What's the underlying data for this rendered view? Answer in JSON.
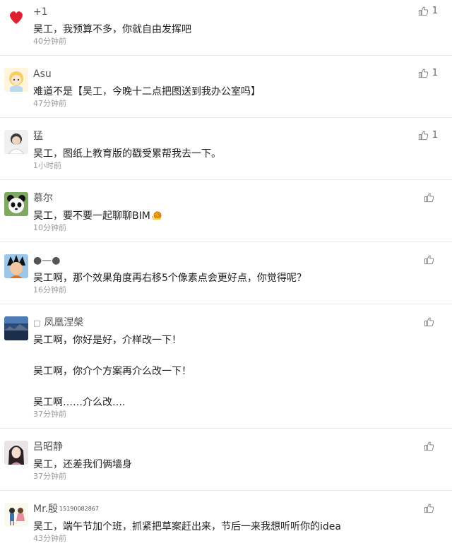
{
  "comments": [
    {
      "name": "+1",
      "text": [
        "吴工，我预算不多，你就自由发挥吧"
      ],
      "time": "40分钟前",
      "likes": "1",
      "avatar_icon": "red-heart-avatar-icon"
    },
    {
      "name": "Asu",
      "text": [
        "难道不是【吴工，今晚十二点把图送到我办公室吗】"
      ],
      "time": "47分钟前",
      "likes": "1",
      "avatar_icon": "anime-girl-avatar-icon"
    },
    {
      "name": "猛",
      "text": [
        "吴工，图纸上教育版的戳受累帮我去一下。"
      ],
      "time": "1小时前",
      "likes": "1",
      "avatar_icon": "boy-avatar-icon"
    },
    {
      "name": "慕尔",
      "text": [
        "吴工，要不要一起聊聊BIM"
      ],
      "time": "10分钟前",
      "likes": "",
      "avatar_icon": "panda-avatar-icon"
    },
    {
      "name": "●—●",
      "text": [
        "吴工啊，那个效果角度再右移5个像素点会更好点，你觉得呢？"
      ],
      "time": "16分钟前",
      "likes": "",
      "avatar_icon": "cartoon-hero-avatar-icon"
    },
    {
      "name": "凤凰涅槃",
      "name_prefix": "□",
      "text": [
        "吴工啊，你好是好，介样改一下！",
        "",
        "吴工啊，你介个方案再介么改一下！",
        "",
        "吴工啊……介么改…."
      ],
      "time": "37分钟前",
      "likes": "",
      "avatar_icon": "landscape-avatar-icon"
    },
    {
      "name": "吕昭静",
      "text": [
        "吴工，还差我们俩墙身"
      ],
      "time": "37分钟前",
      "likes": "",
      "avatar_icon": "girl-avatar-icon"
    },
    {
      "name": "Mr.殷",
      "name_sup": "15190082867",
      "text": [
        "吴工，端午节加个班，抓紧把草案赶出来，节后一来我想听听你的idea"
      ],
      "time": "43分钟前",
      "likes": "",
      "avatar_icon": "couple-avatar-icon"
    }
  ],
  "icons": {
    "like": "thumbs-up-icon",
    "snail_emoji": "snail-emoji-icon"
  }
}
